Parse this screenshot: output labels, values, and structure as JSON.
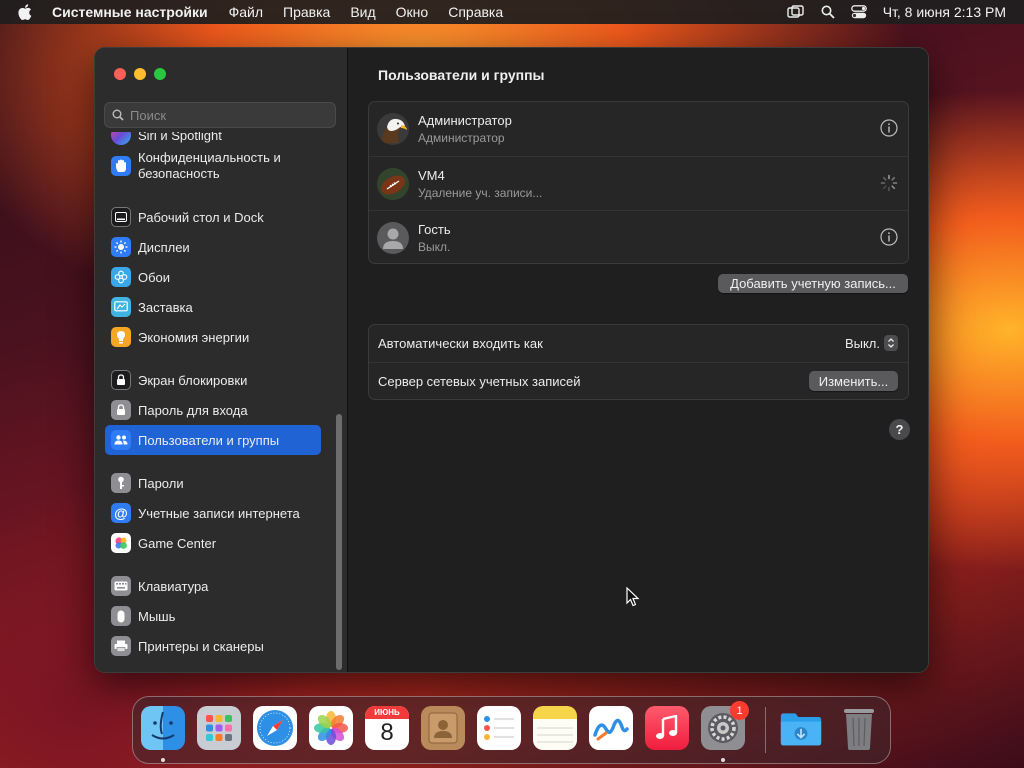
{
  "menubar": {
    "app_name": "Системные настройки",
    "items": [
      "Файл",
      "Правка",
      "Вид",
      "Окно",
      "Справка"
    ],
    "datetime": "Чт, 8 июня  2:13 PM"
  },
  "sidebar": {
    "search_placeholder": "Поиск",
    "items": [
      {
        "label": "Siri и Spotlight",
        "icon": "siri-icon",
        "color": "#6a4bd8"
      },
      {
        "label": "Конфиденциальность и безопасность",
        "icon": "hand-icon",
        "color": "#2f7cf6"
      },
      {
        "label": "Рабочий стол и Dock",
        "icon": "dock-icon",
        "color": "#1c1c1e"
      },
      {
        "label": "Дисплеи",
        "icon": "sun-icon",
        "color": "#2f7cf6"
      },
      {
        "label": "Обои",
        "icon": "flower-icon",
        "color": "#3aa8e8"
      },
      {
        "label": "Заставка",
        "icon": "screensaver-icon",
        "color": "#40b4e0"
      },
      {
        "label": "Экономия энергии",
        "icon": "bulb-icon",
        "color": "#f5a623"
      },
      {
        "label": "Экран блокировки",
        "icon": "lock-screen-icon",
        "color": "#1c1c1e"
      },
      {
        "label": "Пароль для входа",
        "icon": "lock-icon",
        "color": "#8e8e93"
      },
      {
        "label": "Пользователи и группы",
        "icon": "users-icon",
        "color": "#2f7cf6"
      },
      {
        "label": "Пароли",
        "icon": "key-icon",
        "color": "#8e8e93"
      },
      {
        "label": "Учетные записи интернета",
        "icon": "at-icon",
        "color": "#2f7cf6"
      },
      {
        "label": "Game Center",
        "icon": "game-center-icon",
        "color": "#ffffff"
      },
      {
        "label": "Клавиатура",
        "icon": "keyboard-icon",
        "color": "#8e8e93"
      },
      {
        "label": "Мышь",
        "icon": "mouse-icon",
        "color": "#8e8e93"
      },
      {
        "label": "Принтеры и сканеры",
        "icon": "printer-icon",
        "color": "#8e8e93"
      }
    ]
  },
  "main": {
    "title": "Пользователи и группы",
    "users": [
      {
        "name": "Администратор",
        "role": "Администратор",
        "avatar": "eagle-avatar",
        "action": "info-icon"
      },
      {
        "name": "VM4",
        "role": "Удаление уч. записи...",
        "avatar": "football-avatar",
        "action": "spinner-icon"
      },
      {
        "name": "Гость",
        "role": "Выкл.",
        "avatar": "guest-avatar",
        "action": "info-icon"
      }
    ],
    "add_account_label": "Добавить учетную запись...",
    "auto_login_label": "Автоматически входить как",
    "auto_login_value": "Выкл.",
    "network_server_label": "Сервер сетевых учетных записей",
    "change_label": "Изменить...",
    "help_label": "?"
  },
  "dock": {
    "apps": [
      "Finder",
      "Launchpad",
      "Safari",
      "Фото",
      "Календарь",
      "Контакты",
      "Напоминания",
      "Заметки",
      "Freeform",
      "Музыка",
      "Системные настройки",
      "Загрузки",
      "Корзина"
    ],
    "calendar_month": "ИЮНЬ",
    "calendar_day": "8",
    "settings_badge": "1"
  },
  "colors": {
    "accent": "#1f63d4",
    "window_bg": "#1f1f1f",
    "sidebar_bg": "#2c2c2d"
  }
}
